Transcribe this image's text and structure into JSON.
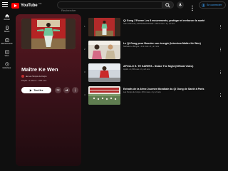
{
  "header": {
    "logo_text": "YouTube",
    "region": "FR",
    "search_placeholder": "Rechercher",
    "signin_label": "Se connecter"
  },
  "guide": {
    "items": [
      {
        "label": "Accueil",
        "icon": "home-icon"
      },
      {
        "label": "Shorts",
        "icon": "shorts-icon"
      },
      {
        "label": "Abonnements",
        "icon": "subscriptions-icon"
      },
      {
        "label": "Vous",
        "icon": "you-icon"
      },
      {
        "label": "Historique",
        "icon": "history-icon"
      }
    ]
  },
  "playlist": {
    "title": "Maître Ke Wen",
    "owner": "de Les Temps du Corps",
    "meta": "Playlist • 4 vidéos • 1 786 vues",
    "play_all_label": "Tout lire",
    "accent": "#5a1820"
  },
  "videos": [
    {
      "index": "1",
      "title": "Qi Gong 1'Forme Les 8 mouvements, protéger et renforcer la santé",
      "meta": "Jean Chaumet | LAOGAGE POULET • 200 k vues • il y a 2 ans"
    },
    {
      "index": "2",
      "title": "Le Qi Gong pour Booster son énergie (Interview Maître Ke Wen)",
      "meta": "Nathalie Le Borgne • 11 k vues • il y a 3 ans"
    },
    {
      "index": "3",
      "title": "APOLLO ft. TE KAREPA - Shake The Night (Official Video)",
      "meta": "Apollo • 1,8 M vues • il y a 6 ans"
    },
    {
      "index": "4",
      "title": "Extraits de la 4ème Journée Mondiale du Qi Gong de Santé à Paris",
      "meta": "Les Temps du Corps • 8,6 k vues • il y a 6 ans"
    }
  ]
}
